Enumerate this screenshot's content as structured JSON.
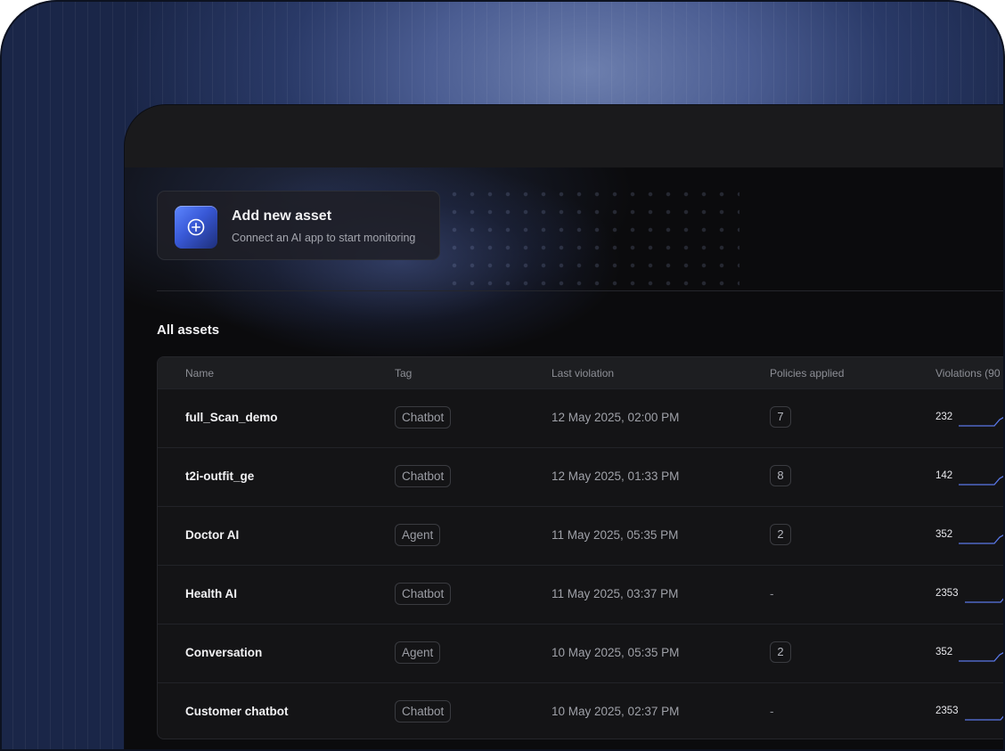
{
  "add_asset": {
    "title": "Add new asset",
    "subtitle": "Connect an AI app to start monitoring",
    "icon": "plus-circle-icon"
  },
  "section_title": "All assets",
  "columns": [
    "Name",
    "Tag",
    "Last violation",
    "Policies applied",
    "Violations (90"
  ],
  "rows": [
    {
      "name": "full_Scan_demo",
      "tag": "Chatbot",
      "last_violation": "12 May 2025, 02:00 PM",
      "policies": "7",
      "violations": "232"
    },
    {
      "name": "t2i-outfit_ge",
      "tag": "Chatbot",
      "last_violation": "12 May 2025, 01:33 PM",
      "policies": "8",
      "violations": "142"
    },
    {
      "name": "Doctor AI",
      "tag": "Agent",
      "last_violation": "11 May 2025, 05:35 PM",
      "policies": "2",
      "violations": "352"
    },
    {
      "name": "Health AI",
      "tag": "Chatbot",
      "last_violation": "11 May 2025, 03:37 PM",
      "policies": "-",
      "violations": "2353"
    },
    {
      "name": "Conversation",
      "tag": "Agent",
      "last_violation": "10 May 2025, 05:35 PM",
      "policies": "2",
      "violations": "352"
    },
    {
      "name": "Customer chatbot",
      "tag": "Chatbot",
      "last_violation": "10 May 2025, 02:37 PM",
      "policies": "-",
      "violations": "2353"
    }
  ],
  "colors": {
    "accent": "#4f6fe8",
    "sparkline": "#5a78e8"
  }
}
